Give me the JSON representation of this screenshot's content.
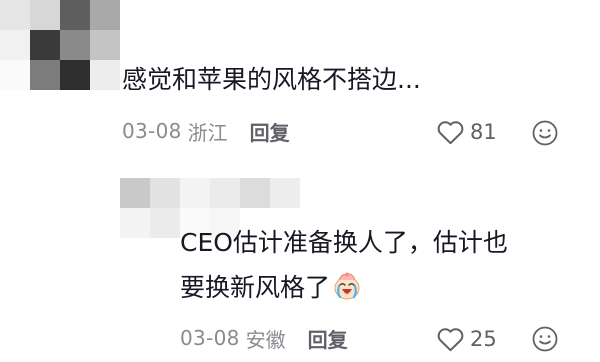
{
  "colors": {
    "text_primary": "#161823",
    "text_meta": "#8a8b91",
    "reply": "#5f6068"
  },
  "comments": [
    {
      "text": "感觉和苹果的风格不搭边...",
      "date": "03-08",
      "location": "浙江",
      "reply_label": "回复",
      "like_count": "81",
      "like_icon": "heart-outline-icon",
      "emoji_button_icon": "smiley-face-icon"
    },
    {
      "text_line1": "CEO估计准备换人了，估计也",
      "text_line2": "要换新风格了",
      "inline_emoji": "crying-laughing-baby-icon",
      "date": "03-08",
      "location": "安徽",
      "reply_label": "回复",
      "like_count": "25",
      "like_icon": "heart-outline-icon",
      "emoji_button_icon": "smiley-face-icon"
    }
  ]
}
